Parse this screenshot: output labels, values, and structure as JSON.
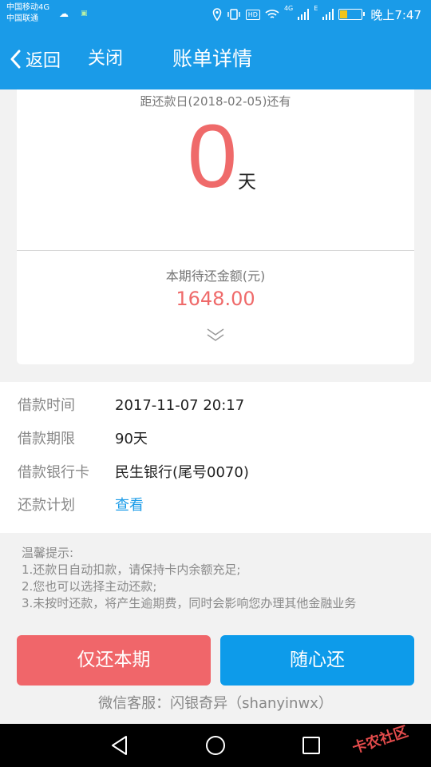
{
  "status_bar": {
    "carrier_1": "中国移动4G",
    "carrier_2": "中国联通",
    "net_1": "4G",
    "net_2": "E",
    "hd_badge": "HD",
    "time": "晚上7:47",
    "battery_level": 0.3
  },
  "nav": {
    "back_label": "返回",
    "close_label": "关闭",
    "title": "账单详情"
  },
  "summary": {
    "due_label": "距还款日(2018-02-05)还有",
    "days_remaining": "0",
    "days_unit": "天",
    "amount_label": "本期待还金额(元)",
    "amount_value": "1648.00"
  },
  "details": {
    "rows": [
      {
        "label": "借款时间",
        "value": "2017-11-07 20:17"
      },
      {
        "label": "借款期限",
        "value": "90天"
      },
      {
        "label": "借款银行卡",
        "value": "民生银行(尾号0070)"
      },
      {
        "label": "还款计划",
        "value": "查看"
      }
    ]
  },
  "tips": {
    "title": "温馨提示:",
    "lines": [
      "1.还款日自动扣款，请保持卡内余额充足;",
      "2.您也可以选择主动还款;",
      "3.未按时还款，将产生逾期费，同时会影响您办理其他金融业务"
    ]
  },
  "buttons": {
    "pay_current": "仅还本期",
    "pay_flexible": "随心还"
  },
  "service_text": "微信客服：闪银奇异（shanyinwx）",
  "watermark_text": "卡农社区",
  "colors": {
    "primary": "#1a9be8",
    "accent_red": "#ef6a6a",
    "button_red": "#f0666a",
    "button_blue": "#0d9bea"
  }
}
